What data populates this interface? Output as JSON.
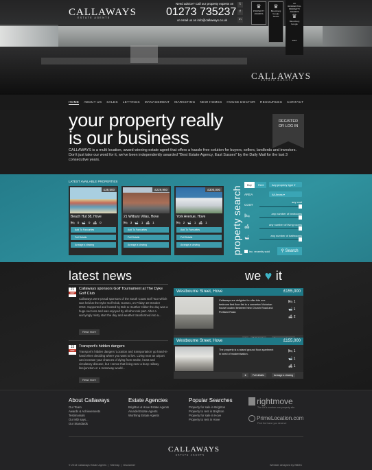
{
  "header": {
    "logo_main": "CALLAWAYS",
    "logo_sub": "ESTATE AGENTS",
    "advice_text": "Need advice? Call our property experts on",
    "phone": "01273 735237",
    "email_text": "or email us on info@callaways.co.uk",
    "awards": [
      {
        "lines": [
          "UK",
          "PROPERTY",
          "AWARDS"
        ]
      },
      {
        "lines": [
          "UK",
          "PROPERTY",
          "AWARDS"
        ]
      },
      {
        "lines": [
          "UK",
          "RESIDENTIAL",
          "PROPERTY",
          "AWARDS"
        ]
      }
    ],
    "award_tags": [
      "PROPERTY AWARDS",
      "Bloomberg",
      "Google",
      "Bloomberg",
      "Google",
      "Savills",
      "2010"
    ],
    "hero_logo_main": "CALLAWAYS",
    "hero_logo_sub": "ESTATE AGENTS"
  },
  "nav": {
    "items": [
      "HOME",
      "ABOUT US",
      "SALES",
      "LETTINGS",
      "MANAGEMENT",
      "MARKETING",
      "NEW HOMES",
      "HOUSE DOCTOR",
      "RESOURCES",
      "CONTACT"
    ]
  },
  "intro": {
    "tagline_1": "your property really",
    "tagline_2": "is our business",
    "text": "CALLAWAYS is a multi location, award winning estate agent that offers a hassle free solution for buyers, sellers, landlords and investors. Don't just take our word for it, we've been independently awarded \"Best Estate Agency, East Sussex\" by the Daily Mail for the last 3 consecutive years.",
    "register_1": "REGISTER",
    "register_2": "OR LOG IN"
  },
  "properties": {
    "label": "LATEST AVAILABLE PROPERTIES",
    "cards": [
      {
        "price": "£38,500",
        "address": "Beach Hut 38, Hove",
        "beds": "0",
        "baths": "0",
        "rooms": "0",
        "img": "#7ab3c4"
      },
      {
        "price": "£229,950",
        "address": "21 Wilbury Villas, Hove",
        "beds": "3",
        "baths": "1",
        "rooms": "1",
        "img": "#8a6a55"
      },
      {
        "price": "£300,000",
        "address": "York Avenue, Hove",
        "beds": "2",
        "baths": "1",
        "rooms": "1",
        "img": "#3f7fb0"
      }
    ],
    "btn_fav": "Add To Favourites",
    "btn_details": "Full Details",
    "btn_view": "Arrange a viewing"
  },
  "search": {
    "title": "property search",
    "buy": "Buy",
    "rent": "Rent",
    "type": "Any property type",
    "area_label": "AREA",
    "area_value": "All Areas",
    "cost_label": "COST",
    "any_cost": "any cost",
    "any_beds": "any number of bedrooms",
    "any_living": "any number of living rooms",
    "any_baths": "any number of bathrooms",
    "inc_sold": "inc. recently sold",
    "search_btn": "Search"
  },
  "news": {
    "heading": "latest news",
    "posts": [
      {
        "day": "21",
        "month": "OCT",
        "title": "Callaways sponsors Golf Tournament at The Dyke Golf Club",
        "body": "Callaways were proud sponsors of the South Coast Golf Tour which was held at the Dyke Golf Club, Sussex, on Friday 18 October 2013. Supported and hosted by Bob & Heather Hilder the day was a huge success and was enjoyed by all who took part. After a worryingly misty start the day and weather transformed into a..."
      },
      {
        "day": "15",
        "month": "OCT",
        "title": "Transport's hidden dangers",
        "body": "Transport's hidden dangers 'Location and transportation' go hand-in-hand when deciding where you want to live. Living near an airport can increase your chances of dying from stroke, heart and circulatory disease, but I sense that living near a busy railway line/junction or a motorway would..."
      }
    ],
    "read_more": "Read more"
  },
  "love": {
    "heading_we": "we",
    "heading_it": "it",
    "listings": [
      {
        "title": "Westbourne Street, Hove",
        "price": "£155,000",
        "desc": "Callaways are delighted to offer this one bedroom first floor flat in a converted Victorian house located between New Church Road and Portland Road.",
        "beds": "1",
        "baths": "1",
        "rooms": "2"
      },
      {
        "title": "Westbourne Street, Hove",
        "price": "£155,000",
        "desc": "The property is a raised ground floor apartment in need of modernisation.",
        "beds": "1",
        "baths": "1",
        "rooms": "1"
      }
    ],
    "btn_details": "Full details",
    "btn_view": "Arrange a viewing"
  },
  "footer": {
    "col1_title": "About Callaways",
    "col1_items": [
      "Our Team",
      "Awards & Achievements",
      "Testimonials",
      "Our MD says...",
      "Our Standards"
    ],
    "col2_title": "Estate Agencies",
    "col2_items": [
      "Brighton & Hove Estate Agents",
      "Arundel Estate Agents",
      "Worthing Estate Agents"
    ],
    "col3_title": "Popular Searches",
    "col3_items": [
      "Property for sale in Brighton",
      "Property to rent in Brighton",
      "Property for sale in Hove",
      "Property to rent in Hove"
    ],
    "rightmove": "rightmove",
    "rightmove_sub": "The UK's number one property site",
    "primelocation": "PrimeLocation.com",
    "primelocation_sub": "Find the home you deserve",
    "logo_main": "CALLAWAYS",
    "logo_sub": "ESTATE AGENTS",
    "copyright": "© 2013 Callaways Estate Agents",
    "sitemap": "Sitemap",
    "disclaimer": "Disclaimer",
    "credit": "Website designed by BBMC"
  },
  "colors": {
    "teal": "#2c8a98",
    "dark": "#1c1c1c",
    "heart": "#3fb4c6"
  }
}
